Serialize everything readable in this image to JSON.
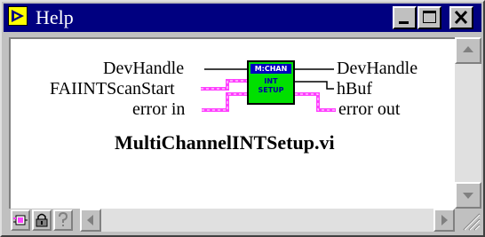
{
  "window": {
    "title": "Help"
  },
  "vi": {
    "icon_header": "M:CHAN",
    "icon_lines": [
      "INT",
      "SETUP"
    ],
    "inputs": [
      "DevHandle",
      "FAIINTScanStart",
      "error in"
    ],
    "outputs": [
      "DevHandle",
      "hBuf",
      "error out"
    ],
    "name": "MultiChannelINTSetup.vi"
  },
  "icons": {
    "app": "labview-help-icon",
    "minimize": "minimize-icon",
    "maximize": "maximize-icon",
    "close": "close-icon",
    "lock": "lock-icon",
    "detail": "detail-icon",
    "question": "question-icon"
  },
  "colors": {
    "titlebar": "#000080",
    "icon_bg": "#00e000",
    "cluster_wire": "#ff40ff"
  }
}
